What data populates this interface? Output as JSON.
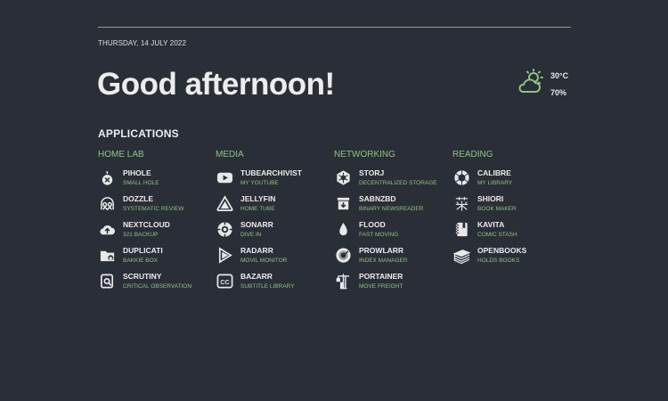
{
  "header": {
    "date": "THURSDAY, 14 JULY 2022",
    "greeting": "Good afternoon!"
  },
  "weather": {
    "icon": "partly-cloudy-icon",
    "temperature": "30°C",
    "humidity": "70%"
  },
  "section_title": "APPLICATIONS",
  "groups": [
    {
      "title": "HOME LAB",
      "apps": [
        {
          "name": "PIHOLE",
          "desc": "SMALL HOLE",
          "icon": "pihole-icon"
        },
        {
          "name": "DOZZLE",
          "desc": "SYSTEMATIC REVIEW",
          "icon": "dozzle-icon"
        },
        {
          "name": "NEXTCLOUD",
          "desc": "321 BACKUP",
          "icon": "cloud-upload-icon"
        },
        {
          "name": "DUPLICATI",
          "desc": "BAKKIE BOX",
          "icon": "folder-location-icon"
        },
        {
          "name": "SCRUTINY",
          "desc": "CRITICAL OBSERVATION",
          "icon": "scrutiny-icon"
        }
      ]
    },
    {
      "title": "MEDIA",
      "apps": [
        {
          "name": "TUBEARCHIVIST",
          "desc": "MY YOUTUBE",
          "icon": "youtube-icon"
        },
        {
          "name": "JELLYFIN",
          "desc": "HOME TUBE",
          "icon": "jellyfin-icon"
        },
        {
          "name": "SONARR",
          "desc": "DIVE IN",
          "icon": "sonarr-icon"
        },
        {
          "name": "RADARR",
          "desc": "MOVIL MONITOR",
          "icon": "radarr-icon"
        },
        {
          "name": "BAZARR",
          "desc": "SUBTITLE LIBRARY",
          "icon": "closed-caption-icon"
        }
      ]
    },
    {
      "title": "NETWORKING",
      "apps": [
        {
          "name": "STORJ",
          "desc": "DECENTRALIZED STORAGE",
          "icon": "storj-icon"
        },
        {
          "name": "SABNZBD",
          "desc": "BINARY NEWSREADER",
          "icon": "download-box-icon"
        },
        {
          "name": "FLOOD",
          "desc": "FAST MOVING",
          "icon": "water-drop-icon"
        },
        {
          "name": "PROWLARR",
          "desc": "INDEX MANAGER",
          "icon": "prowlarr-icon"
        },
        {
          "name": "PORTAINER",
          "desc": "MOVE FREIGHT",
          "icon": "crane-icon"
        }
      ]
    },
    {
      "title": "READING",
      "apps": [
        {
          "name": "CALIBRE",
          "desc": "MY LIBRARY",
          "icon": "calibre-icon"
        },
        {
          "name": "SHIORI",
          "desc": "BOOK MAKER",
          "icon": "kanji-icon"
        },
        {
          "name": "KAVITA",
          "desc": "COMIC STASH",
          "icon": "notebook-icon"
        },
        {
          "name": "OPENBOOKS",
          "desc": "HOLDS BOOKS",
          "icon": "book-stack-icon"
        }
      ]
    }
  ]
}
